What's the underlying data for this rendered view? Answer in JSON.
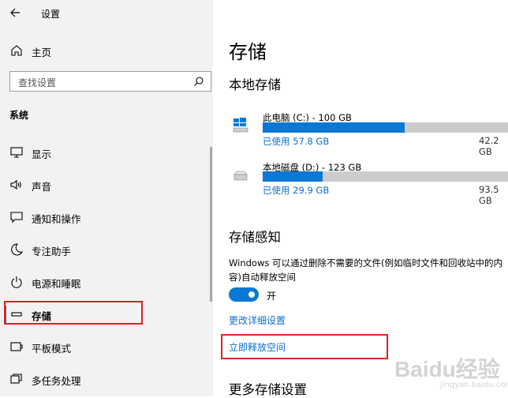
{
  "window": {
    "title": "设置"
  },
  "sidebar": {
    "home_label": "主页",
    "search_placeholder": "查找设置",
    "section_title": "系统",
    "items": [
      {
        "label": "显示",
        "icon": "monitor-icon"
      },
      {
        "label": "声音",
        "icon": "speaker-icon"
      },
      {
        "label": "通知和操作",
        "icon": "notification-icon"
      },
      {
        "label": "专注助手",
        "icon": "moon-icon"
      },
      {
        "label": "电源和睡眠",
        "icon": "power-icon"
      },
      {
        "label": "存储",
        "icon": "storage-icon",
        "selected": true
      },
      {
        "label": "平板模式",
        "icon": "tablet-icon"
      },
      {
        "label": "多任务处理",
        "icon": "multitask-icon"
      }
    ]
  },
  "main": {
    "title": "存储",
    "local_storage_heading": "本地存储",
    "drives": [
      {
        "name": "此电脑 (C:) - 100 GB",
        "used": "已使用 57.8 GB",
        "free": "42.2 GB",
        "used_fraction": 0.578,
        "icon": "windows-drive-icon"
      },
      {
        "name": "本地磁盘 (D:) - 123 GB",
        "used": "已使用 29.9 GB",
        "free": "93.5 GB",
        "used_fraction": 0.243,
        "icon": "disk-drive-icon"
      }
    ],
    "storage_sense_heading": "存储感知",
    "storage_sense_desc": "Windows 可以通过删除不需要的文件(例如临时文件和回收站中的内容)自动释放空间",
    "toggle_state": "开",
    "change_link": "更改详细设置",
    "free_now_link": "立即释放空间",
    "more_heading": "更多存储设置"
  },
  "watermark": {
    "big": "Baidu经验",
    "small": "jingyan.baidu.com"
  },
  "colors": {
    "accent": "#0a78d4",
    "highlight": "#e02020",
    "sidebar_bg": "#f2f2f2"
  }
}
